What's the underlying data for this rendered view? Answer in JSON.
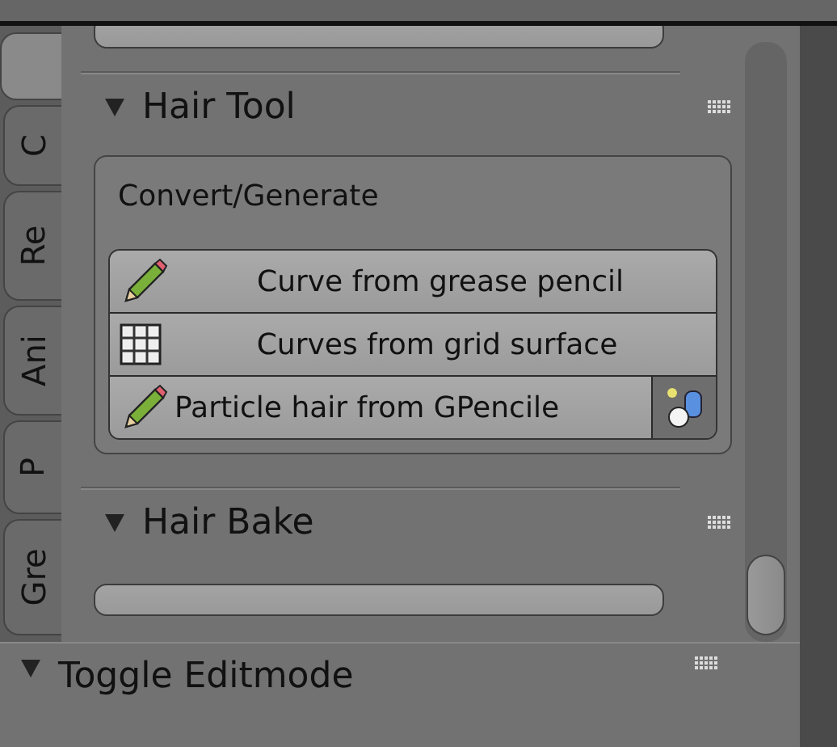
{
  "side_tabs": [
    {
      "selected": true
    },
    {
      "label": "C",
      "selected": false
    },
    {
      "label": "Re",
      "selected": false
    },
    {
      "label": "Ani",
      "selected": false
    },
    {
      "label": "P",
      "selected": false
    },
    {
      "label": "Gre",
      "selected": false
    }
  ],
  "panels": [
    {
      "title": "Hair Tool",
      "expanded": true,
      "box_label": "Convert/Generate",
      "buttons": [
        {
          "label": "Curve from grease pencil",
          "kind": "pencil"
        },
        {
          "label": "Curves from grid surface",
          "kind": "grid"
        },
        {
          "label": "Particle hair from GPencile",
          "kind": "pencil-option"
        }
      ]
    },
    {
      "title": "Hair Bake",
      "expanded": true
    }
  ],
  "bottom_panel": {
    "title": "Toggle Editmode",
    "expanded": true
  }
}
